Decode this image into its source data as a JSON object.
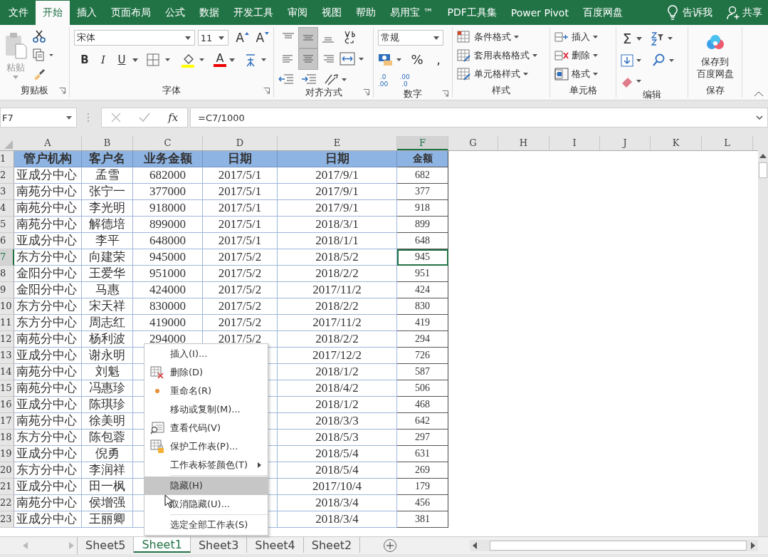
{
  "ribbon_tabs": [
    {
      "label": "文件",
      "selected": false
    },
    {
      "label": "开始",
      "selected": true
    },
    {
      "label": "插入",
      "selected": false
    },
    {
      "label": "页面布局",
      "selected": false
    },
    {
      "label": "公式",
      "selected": false
    },
    {
      "label": "数据",
      "selected": false
    },
    {
      "label": "开发工具",
      "selected": false
    },
    {
      "label": "审阅",
      "selected": false
    },
    {
      "label": "视图",
      "selected": false
    },
    {
      "label": "帮助",
      "selected": false
    },
    {
      "label": "易用宝 ™",
      "selected": false
    },
    {
      "label": "PDF工具集",
      "selected": false
    },
    {
      "label": "Power Pivot",
      "selected": false
    },
    {
      "label": "百度网盘",
      "selected": false
    }
  ],
  "tell_me": "告诉我",
  "share": "共享",
  "ribbon": {
    "clipboard": {
      "paste": "粘贴",
      "label": "剪贴板"
    },
    "font": {
      "name": "宋体",
      "size": "11",
      "grow": "A",
      "shrink": "A",
      "bold": "B",
      "italic": "I",
      "underline": "U",
      "color_letter": "A",
      "label": "字体"
    },
    "alignment": {
      "vertical": [
        {
          "selected": false
        },
        {
          "selected": true
        },
        {
          "selected": false
        }
      ],
      "horizontal": [
        {
          "selected": false
        },
        {
          "selected": true
        },
        {
          "selected": false
        }
      ],
      "label": "对齐方式"
    },
    "number": {
      "format": "常规",
      "percent": "%",
      "comma": ",",
      "increase_decimal": [
        ".0",
        ".00"
      ],
      "decrease_decimal": [
        ".00",
        ".0"
      ],
      "label": "数字"
    },
    "styles": {
      "items": [
        "条件格式",
        "套用表格格式",
        "单元格样式"
      ],
      "label": "样式"
    },
    "cells": {
      "items": [
        "插入",
        "删除",
        "格式"
      ],
      "label": "单元格"
    },
    "editing": {
      "sum": "Σ",
      "label": "编辑"
    },
    "save": {
      "button": [
        "保存到",
        "百度网盘"
      ],
      "label": "保存"
    }
  },
  "formula_bar": {
    "name_box": "F7",
    "fx": "fx",
    "formula": "=C7/1000"
  },
  "sheet": {
    "columns": [
      {
        "label": "A",
        "selected": false
      },
      {
        "label": "B",
        "selected": false
      },
      {
        "label": "C",
        "selected": false
      },
      {
        "label": "D",
        "selected": false
      },
      {
        "label": "E",
        "selected": false
      },
      {
        "label": "F",
        "selected": true
      },
      {
        "label": "G",
        "selected": false
      },
      {
        "label": "H",
        "selected": false
      },
      {
        "label": "I",
        "selected": false
      },
      {
        "label": "J",
        "selected": false
      },
      {
        "label": "K",
        "selected": false
      },
      {
        "label": "L",
        "selected": false
      }
    ],
    "header": {
      "number": "1",
      "cells": [
        "管户机构",
        "客户名",
        "业务金额",
        "日期",
        "日期",
        "金额"
      ]
    },
    "rows": [
      {
        "number": "2",
        "selected": false,
        "cells": [
          "亚成分中心",
          "孟雪",
          "682000",
          "2017/5/1",
          "2017/9/1",
          "682"
        ]
      },
      {
        "number": "3",
        "selected": false,
        "cells": [
          "南苑分中心",
          "张宁一",
          "377000",
          "2017/5/1",
          "2017/9/1",
          "377"
        ]
      },
      {
        "number": "4",
        "selected": false,
        "cells": [
          "南苑分中心",
          "李光明",
          "918000",
          "2017/5/1",
          "2017/9/1",
          "918"
        ]
      },
      {
        "number": "5",
        "selected": false,
        "cells": [
          "南苑分中心",
          "解德培",
          "899000",
          "2017/5/1",
          "2018/3/1",
          "899"
        ]
      },
      {
        "number": "6",
        "selected": false,
        "cells": [
          "亚成分中心",
          "李平",
          "648000",
          "2017/5/1",
          "2018/1/1",
          "648"
        ]
      },
      {
        "number": "7",
        "selected": true,
        "cells": [
          "东方分中心",
          "向建荣",
          "945000",
          "2017/5/2",
          "2018/5/2",
          "945"
        ]
      },
      {
        "number": "8",
        "selected": false,
        "cells": [
          "金阳分中心",
          "王爱华",
          "951000",
          "2017/5/2",
          "2018/2/2",
          "951"
        ]
      },
      {
        "number": "9",
        "selected": false,
        "cells": [
          "金阳分中心",
          "马惠",
          "424000",
          "2017/5/2",
          "2017/11/2",
          "424"
        ]
      },
      {
        "number": "10",
        "selected": false,
        "cells": [
          "东方分中心",
          "宋天祥",
          "830000",
          "2017/5/2",
          "2018/2/2",
          "830"
        ]
      },
      {
        "number": "11",
        "selected": false,
        "cells": [
          "东方分中心",
          "周志红",
          "419000",
          "2017/5/2",
          "2017/11/2",
          "419"
        ]
      },
      {
        "number": "12",
        "selected": false,
        "cells": [
          "南苑分中心",
          "杨利波",
          "294000",
          "2017/5/2",
          "2018/2/2",
          "294"
        ]
      },
      {
        "number": "13",
        "selected": false,
        "cells": [
          "亚成分中心",
          "谢永明",
          null,
          null,
          "2017/12/2",
          "726"
        ]
      },
      {
        "number": "14",
        "selected": false,
        "cells": [
          "南苑分中心",
          "刘魁",
          null,
          null,
          "2018/1/2",
          "587"
        ]
      },
      {
        "number": "15",
        "selected": false,
        "cells": [
          "南苑分中心",
          "冯惠珍",
          null,
          null,
          "2018/4/2",
          "506"
        ]
      },
      {
        "number": "16",
        "selected": false,
        "cells": [
          "亚成分中心",
          "陈琪珍",
          null,
          null,
          "2018/1/2",
          "468"
        ]
      },
      {
        "number": "17",
        "selected": false,
        "cells": [
          "南苑分中心",
          "徐美明",
          null,
          null,
          "2018/3/3",
          "642"
        ]
      },
      {
        "number": "18",
        "selected": false,
        "cells": [
          "东方分中心",
          "陈包蓉",
          null,
          null,
          "2018/5/3",
          "297"
        ]
      },
      {
        "number": "19",
        "selected": false,
        "cells": [
          "亚成分中心",
          "倪勇",
          null,
          null,
          "2018/5/4",
          "631"
        ]
      },
      {
        "number": "20",
        "selected": false,
        "cells": [
          "东方分中心",
          "李润祥",
          null,
          null,
          "2018/5/4",
          "269"
        ]
      },
      {
        "number": "21",
        "selected": false,
        "cells": [
          "亚成分中心",
          "田一枫",
          null,
          null,
          "2017/10/4",
          "179"
        ]
      },
      {
        "number": "22",
        "selected": false,
        "cells": [
          "南苑分中心",
          "侯增强",
          null,
          null,
          "2018/3/4",
          "456"
        ]
      },
      {
        "number": "23",
        "selected": false,
        "cells": [
          "亚成分中心",
          "王丽卿",
          null,
          null,
          "2018/3/4",
          "381"
        ]
      }
    ]
  },
  "context_menu": {
    "sections": [
      [
        {
          "label": "插入(I)...",
          "selected": false,
          "submenu": false
        },
        {
          "label": "删除(D)",
          "selected": false,
          "submenu": false
        },
        {
          "label": "重命名(R)",
          "selected": false,
          "submenu": false
        },
        {
          "label": "移动或复制(M)...",
          "selected": false,
          "submenu": false
        },
        {
          "label": "查看代码(V)",
          "selected": false,
          "submenu": false
        },
        {
          "label": "保护工作表(P)...",
          "selected": false,
          "submenu": false
        },
        {
          "label": "工作表标签颜色(T)",
          "selected": false,
          "submenu": true
        }
      ],
      [
        {
          "label": "隐藏(H)",
          "selected": true,
          "submenu": false
        },
        {
          "label": "取消隐藏(U)...",
          "selected": false,
          "submenu": false
        }
      ],
      [
        {
          "label": "选定全部工作表(S)",
          "selected": false,
          "submenu": false
        }
      ]
    ]
  },
  "sheet_tabs": [
    {
      "label": "Sheet5",
      "selected": false
    },
    {
      "label": "Sheet1",
      "selected": true
    },
    {
      "label": "Sheet3",
      "selected": false
    },
    {
      "label": "Sheet4",
      "selected": false
    },
    {
      "label": "Sheet2",
      "selected": false
    }
  ]
}
